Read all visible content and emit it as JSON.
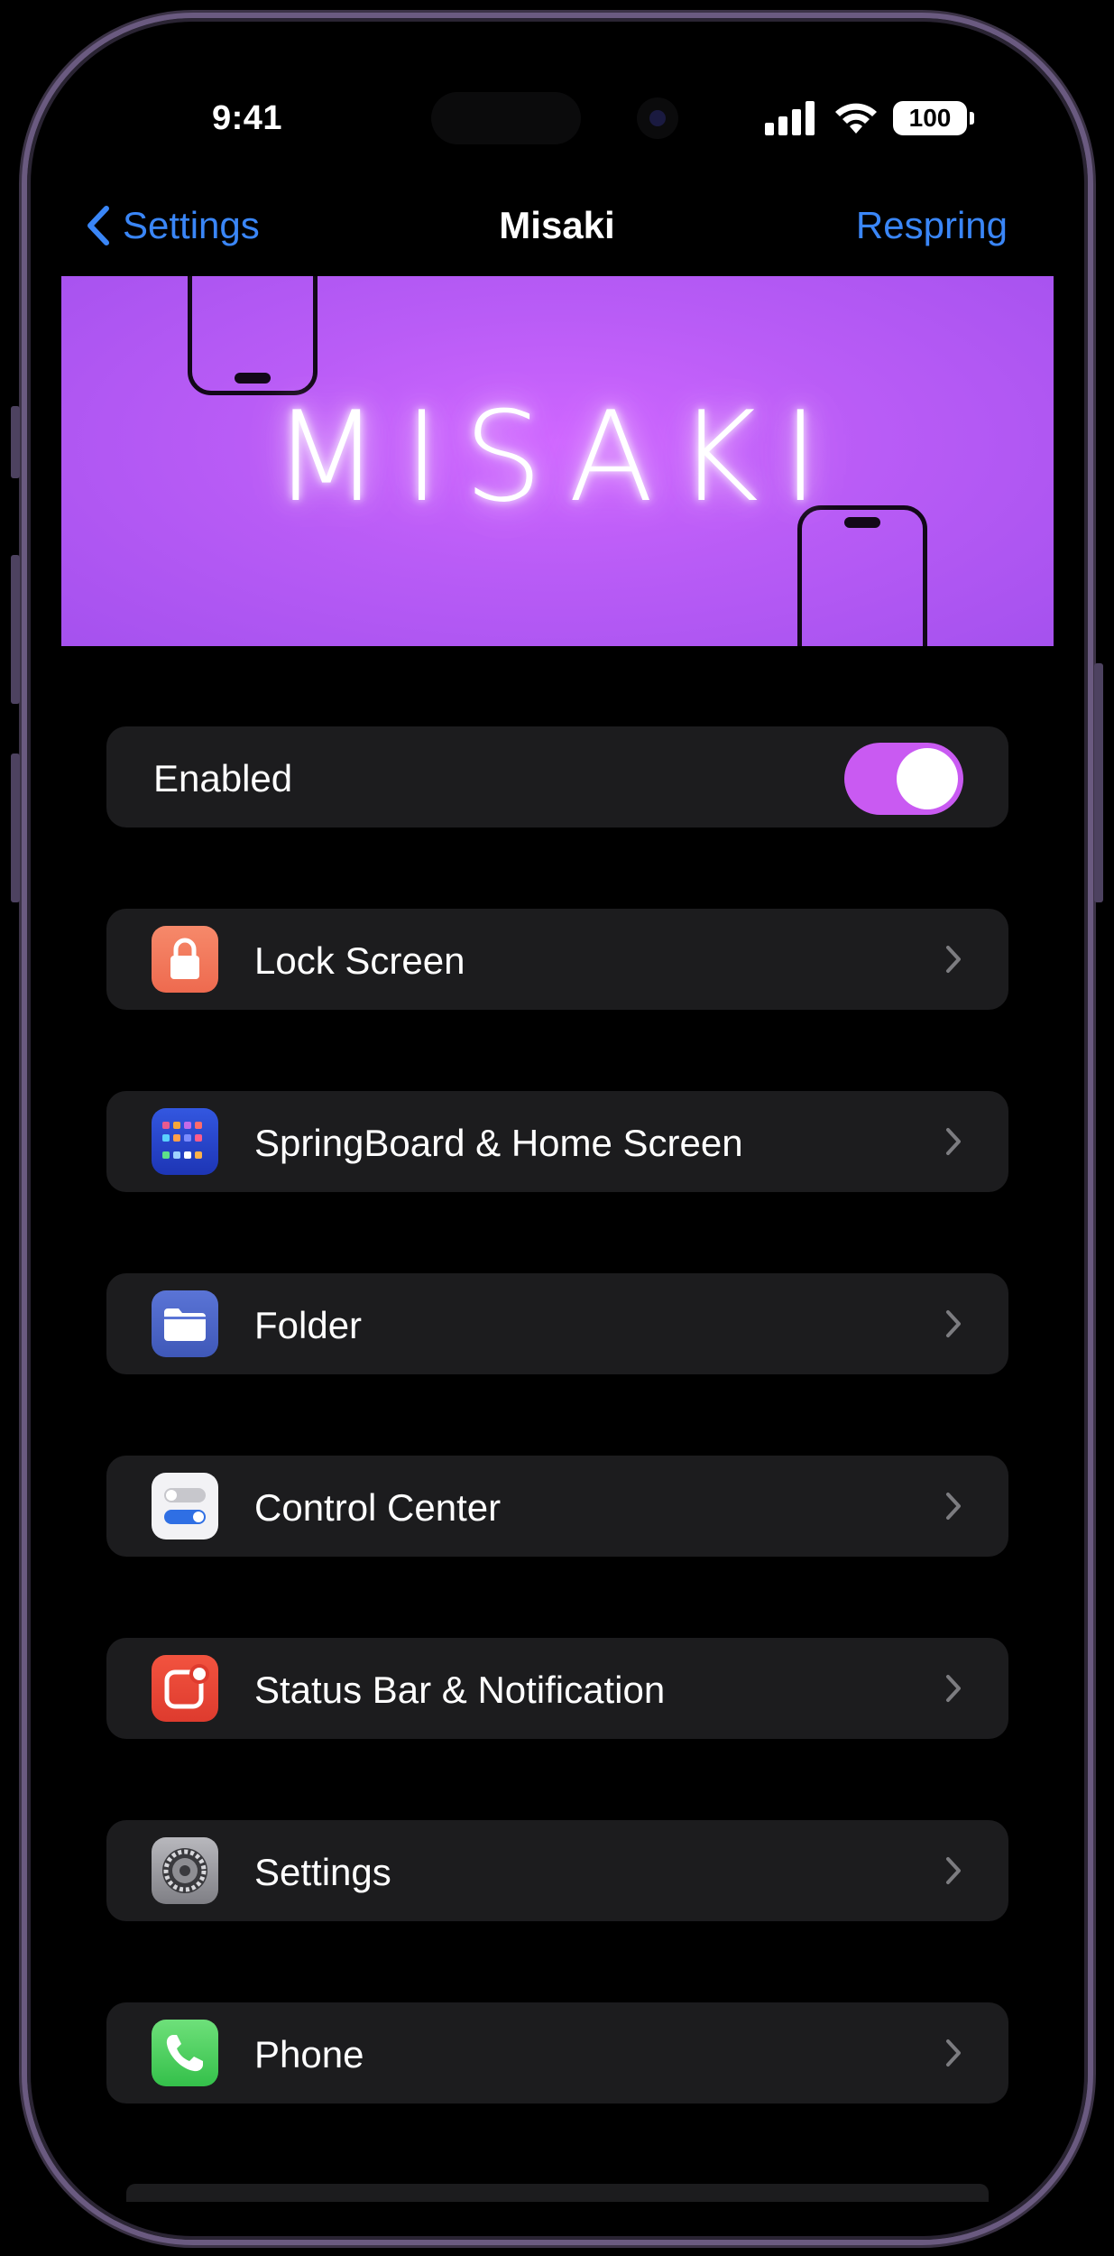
{
  "status_bar": {
    "time": "9:41",
    "battery": "100"
  },
  "nav": {
    "back_label": "Settings",
    "title": "Misaki",
    "action_label": "Respring"
  },
  "banner": {
    "text": "MISAKI"
  },
  "toggle_row": {
    "label": "Enabled",
    "enabled": true
  },
  "menu": [
    {
      "label": "Lock Screen",
      "icon": "lock-icon",
      "color": "#f2785c"
    },
    {
      "label": "SpringBoard & Home Screen",
      "icon": "home-grid-icon",
      "color": "#2744c9"
    },
    {
      "label": "Folder",
      "icon": "folder-icon",
      "color": "#4a63c4"
    },
    {
      "label": "Control Center",
      "icon": "toggles-icon",
      "color": "#f2f2f5"
    },
    {
      "label": "Status Bar & Notification",
      "icon": "notification-icon",
      "color": "#e8473a"
    },
    {
      "label": "Settings",
      "icon": "gear-icon",
      "color": "#8e8e93"
    },
    {
      "label": "Phone",
      "icon": "phone-icon",
      "color": "#3fc653"
    }
  ],
  "colors": {
    "accent": "#3a86f7",
    "toggle_on": "#c95af2",
    "banner": "#b95cf6",
    "row_bg": "#1c1c1e"
  }
}
